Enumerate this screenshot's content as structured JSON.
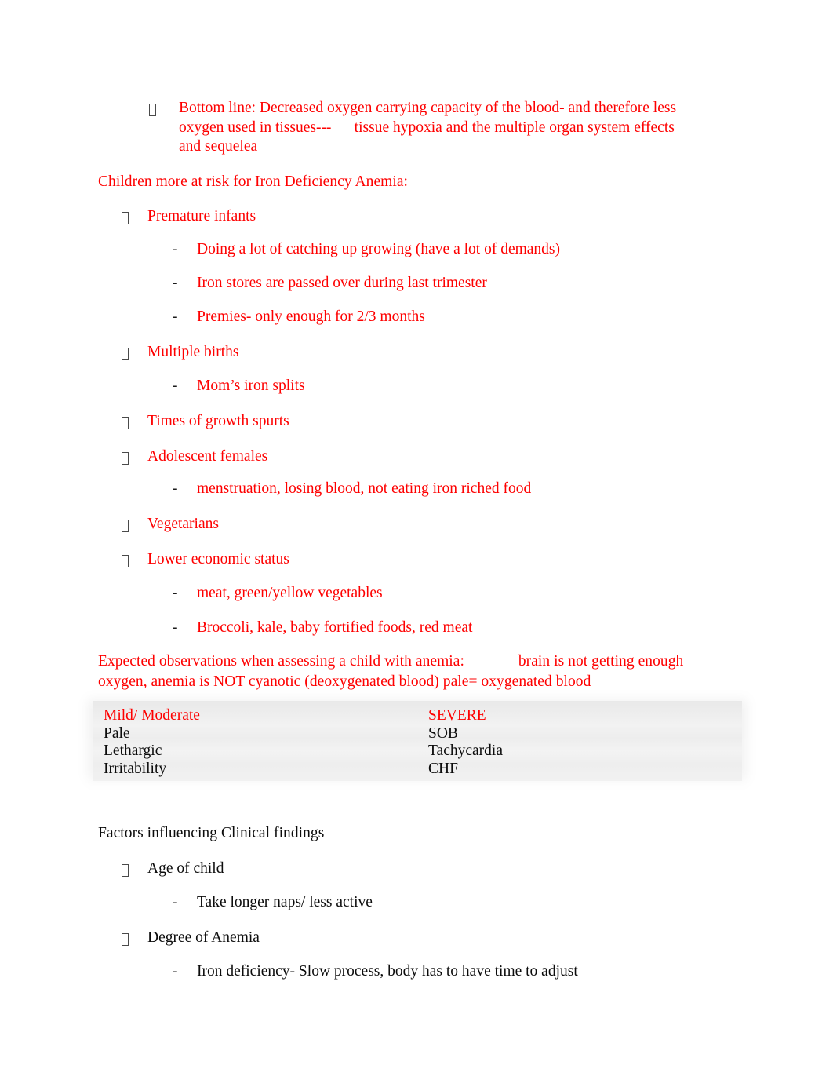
{
  "document": {
    "blocks": [
      {
        "id": "bottom-line-bullet",
        "text": "Bottom line: Decreased oxygen carrying capacity of the blood- and therefore less oxygen used in tissues---      tissue hypoxia and the multiple organ system effects and sequelea"
      }
    ],
    "heading_risk": "Children more at risk for Iron Deficiency Anemia:",
    "risk_items": [
      {
        "label": "Premature infants",
        "subs": [
          "Doing a lot of catching up growing (have a lot of demands)",
          "Iron stores are passed over during last trimester",
          "Premies- only enough for 2/3 months"
        ]
      },
      {
        "label": "Multiple births",
        "subs": [
          "Mom’s iron splits"
        ]
      },
      {
        "label": "Times of growth spurts",
        "subs": []
      },
      {
        "label": "Adolescent females",
        "subs": [
          "menstruation, losing blood, not eating iron riched food"
        ]
      },
      {
        "label": "Vegetarians",
        "subs": []
      },
      {
        "label": "Lower economic status",
        "subs": [
          "meat, green/yellow vegetables",
          "Broccoli, kale, baby fortified foods, red meat"
        ]
      }
    ],
    "expected_observations": {
      "line1": "Expected observations when assessing a child with anemia:              brain is not getting enough",
      "line2": "oxygen, anemia is NOT cyanotic (deoxygenated blood) pale= oxygenated blood"
    },
    "severity_table": {
      "columns": [
        {
          "header": "Mild/ Moderate",
          "cells": [
            "Pale",
            "Lethargic",
            "Irritability"
          ]
        },
        {
          "header": "SEVERE",
          "cells": [
            "SOB",
            "Tachycardia",
            "CHF"
          ]
        }
      ]
    },
    "heading_factors": "Factors influencing Clinical findings",
    "factor_items": [
      {
        "label": "Age of child",
        "subs": [
          "Take longer naps/ less active"
        ]
      },
      {
        "label": "Degree of Anemia",
        "subs": [
          "Iron deficiency- Slow process, body has to have time to adjust"
        ]
      }
    ],
    "colors": {
      "red_text": "#FE0000",
      "black_text": "#0C0C0C",
      "table_fill": "#EFEFEF",
      "bullet_marker": "#4A4A4A"
    },
    "markers": {
      "level1": "tofu-box-bullet",
      "level2": "-"
    }
  }
}
